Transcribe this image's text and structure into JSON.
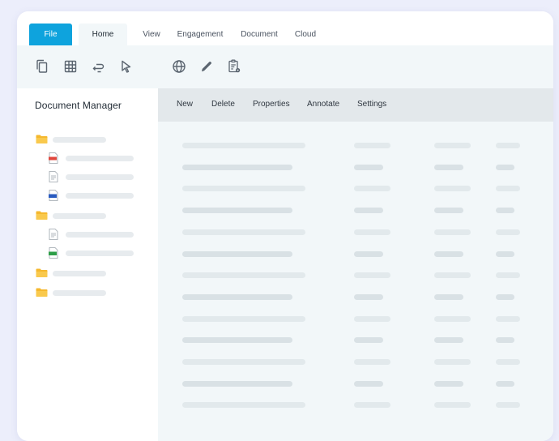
{
  "tabs": [
    {
      "label": "File"
    },
    {
      "label": "Home"
    },
    {
      "label": "View"
    },
    {
      "label": "Engagement"
    },
    {
      "label": "Document"
    },
    {
      "label": "Cloud"
    }
  ],
  "toolbar": {
    "icons": [
      "copy-icon",
      "table-icon",
      "comment-icon",
      "cursor-icon",
      "globe-icon",
      "pencil-icon",
      "clipboard-settings-icon"
    ]
  },
  "sidebar": {
    "title": "Document Manager",
    "tree": [
      {
        "type": "folder",
        "icon": "folder-icon"
      },
      {
        "type": "file",
        "icon": "pdf-file-icon"
      },
      {
        "type": "file",
        "icon": "text-file-icon"
      },
      {
        "type": "file",
        "icon": "word-file-icon"
      },
      {
        "type": "folder",
        "icon": "folder-icon"
      },
      {
        "type": "file",
        "icon": "text-file-icon"
      },
      {
        "type": "file",
        "icon": "excel-file-icon"
      },
      {
        "type": "folder",
        "icon": "folder-icon"
      },
      {
        "type": "folder",
        "icon": "folder-icon"
      }
    ]
  },
  "actions": {
    "new": "New",
    "delete": "Delete",
    "properties": "Properties",
    "annotate": "Annotate",
    "settings": "Settings"
  },
  "colors": {
    "accent": "#0ea3dd",
    "folder": "#f5b82e",
    "pdf": "#e0463c",
    "word": "#2a5bbf",
    "excel": "#2e9e48",
    "background": "#eceefb"
  }
}
